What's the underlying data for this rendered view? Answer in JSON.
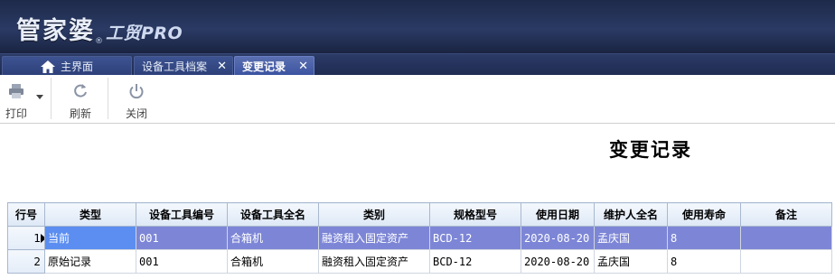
{
  "app": {
    "logo_main": "管家婆",
    "logo_sub": "工贸PRO"
  },
  "tabs": [
    {
      "label": "主界面",
      "icon": "home-icon"
    },
    {
      "label": "设备工具档案",
      "close": "✕"
    },
    {
      "label": "变更记录",
      "close": "✕"
    }
  ],
  "toolbar": {
    "print_label": "打印",
    "refresh_label": "刷新",
    "close_label": "关闭"
  },
  "page": {
    "title": "变更记录"
  },
  "table": {
    "headers": [
      "行号",
      "类型",
      "设备工具编号",
      "设备工具全名",
      "类别",
      "规格型号",
      "使用日期",
      "维护人全名",
      "使用寿命",
      "备注"
    ],
    "rows": [
      {
        "rownum": "1",
        "type": "当前",
        "code": "001",
        "name": "合箱机",
        "category": "融资租入固定资产",
        "model": "BCD-12",
        "date": "2020-08-20",
        "maintainer": "孟庆国",
        "life": "8",
        "note": ""
      },
      {
        "rownum": "2",
        "type": "原始记录",
        "code": "001",
        "name": "合箱机",
        "category": "融资租入固定资产",
        "model": "BCD-12",
        "date": "2020-08-20",
        "maintainer": "孟庆国",
        "life": "8",
        "note": ""
      }
    ]
  },
  "colors": {
    "header_bg": "#1e2a4a",
    "active_tab": "#3b52a0",
    "selected_row": "#7d86d6",
    "selected_cell": "#5b8ef0"
  }
}
